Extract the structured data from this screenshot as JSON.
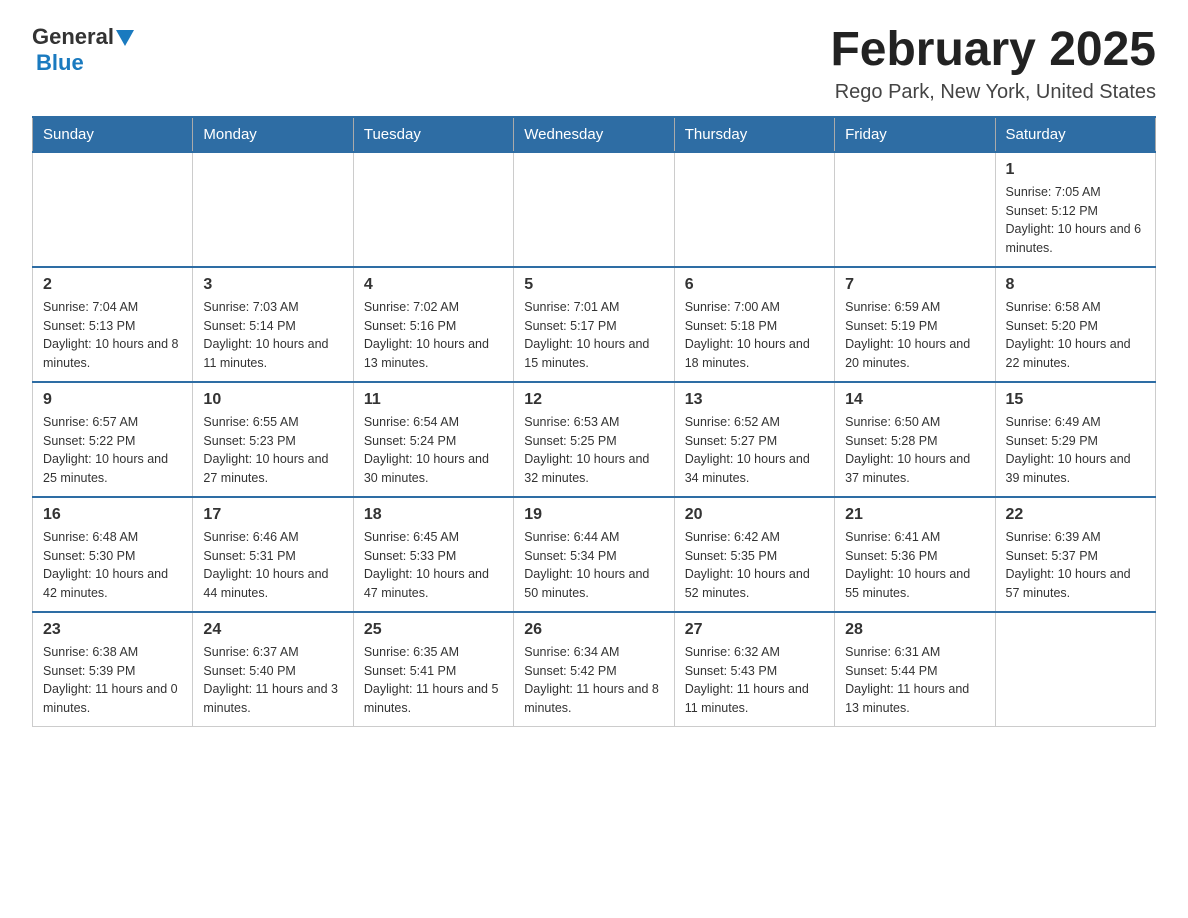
{
  "header": {
    "logo": {
      "general": "General",
      "blue": "Blue",
      "tagline": ""
    },
    "title": "February 2025",
    "location": "Rego Park, New York, United States"
  },
  "calendar": {
    "weekdays": [
      "Sunday",
      "Monday",
      "Tuesday",
      "Wednesday",
      "Thursday",
      "Friday",
      "Saturday"
    ],
    "weeks": [
      [
        {
          "day": "",
          "info": ""
        },
        {
          "day": "",
          "info": ""
        },
        {
          "day": "",
          "info": ""
        },
        {
          "day": "",
          "info": ""
        },
        {
          "day": "",
          "info": ""
        },
        {
          "day": "",
          "info": ""
        },
        {
          "day": "1",
          "info": "Sunrise: 7:05 AM\nSunset: 5:12 PM\nDaylight: 10 hours and 6 minutes."
        }
      ],
      [
        {
          "day": "2",
          "info": "Sunrise: 7:04 AM\nSunset: 5:13 PM\nDaylight: 10 hours and 8 minutes."
        },
        {
          "day": "3",
          "info": "Sunrise: 7:03 AM\nSunset: 5:14 PM\nDaylight: 10 hours and 11 minutes."
        },
        {
          "day": "4",
          "info": "Sunrise: 7:02 AM\nSunset: 5:16 PM\nDaylight: 10 hours and 13 minutes."
        },
        {
          "day": "5",
          "info": "Sunrise: 7:01 AM\nSunset: 5:17 PM\nDaylight: 10 hours and 15 minutes."
        },
        {
          "day": "6",
          "info": "Sunrise: 7:00 AM\nSunset: 5:18 PM\nDaylight: 10 hours and 18 minutes."
        },
        {
          "day": "7",
          "info": "Sunrise: 6:59 AM\nSunset: 5:19 PM\nDaylight: 10 hours and 20 minutes."
        },
        {
          "day": "8",
          "info": "Sunrise: 6:58 AM\nSunset: 5:20 PM\nDaylight: 10 hours and 22 minutes."
        }
      ],
      [
        {
          "day": "9",
          "info": "Sunrise: 6:57 AM\nSunset: 5:22 PM\nDaylight: 10 hours and 25 minutes."
        },
        {
          "day": "10",
          "info": "Sunrise: 6:55 AM\nSunset: 5:23 PM\nDaylight: 10 hours and 27 minutes."
        },
        {
          "day": "11",
          "info": "Sunrise: 6:54 AM\nSunset: 5:24 PM\nDaylight: 10 hours and 30 minutes."
        },
        {
          "day": "12",
          "info": "Sunrise: 6:53 AM\nSunset: 5:25 PM\nDaylight: 10 hours and 32 minutes."
        },
        {
          "day": "13",
          "info": "Sunrise: 6:52 AM\nSunset: 5:27 PM\nDaylight: 10 hours and 34 minutes."
        },
        {
          "day": "14",
          "info": "Sunrise: 6:50 AM\nSunset: 5:28 PM\nDaylight: 10 hours and 37 minutes."
        },
        {
          "day": "15",
          "info": "Sunrise: 6:49 AM\nSunset: 5:29 PM\nDaylight: 10 hours and 39 minutes."
        }
      ],
      [
        {
          "day": "16",
          "info": "Sunrise: 6:48 AM\nSunset: 5:30 PM\nDaylight: 10 hours and 42 minutes."
        },
        {
          "day": "17",
          "info": "Sunrise: 6:46 AM\nSunset: 5:31 PM\nDaylight: 10 hours and 44 minutes."
        },
        {
          "day": "18",
          "info": "Sunrise: 6:45 AM\nSunset: 5:33 PM\nDaylight: 10 hours and 47 minutes."
        },
        {
          "day": "19",
          "info": "Sunrise: 6:44 AM\nSunset: 5:34 PM\nDaylight: 10 hours and 50 minutes."
        },
        {
          "day": "20",
          "info": "Sunrise: 6:42 AM\nSunset: 5:35 PM\nDaylight: 10 hours and 52 minutes."
        },
        {
          "day": "21",
          "info": "Sunrise: 6:41 AM\nSunset: 5:36 PM\nDaylight: 10 hours and 55 minutes."
        },
        {
          "day": "22",
          "info": "Sunrise: 6:39 AM\nSunset: 5:37 PM\nDaylight: 10 hours and 57 minutes."
        }
      ],
      [
        {
          "day": "23",
          "info": "Sunrise: 6:38 AM\nSunset: 5:39 PM\nDaylight: 11 hours and 0 minutes."
        },
        {
          "day": "24",
          "info": "Sunrise: 6:37 AM\nSunset: 5:40 PM\nDaylight: 11 hours and 3 minutes."
        },
        {
          "day": "25",
          "info": "Sunrise: 6:35 AM\nSunset: 5:41 PM\nDaylight: 11 hours and 5 minutes."
        },
        {
          "day": "26",
          "info": "Sunrise: 6:34 AM\nSunset: 5:42 PM\nDaylight: 11 hours and 8 minutes."
        },
        {
          "day": "27",
          "info": "Sunrise: 6:32 AM\nSunset: 5:43 PM\nDaylight: 11 hours and 11 minutes."
        },
        {
          "day": "28",
          "info": "Sunrise: 6:31 AM\nSunset: 5:44 PM\nDaylight: 11 hours and 13 minutes."
        },
        {
          "day": "",
          "info": ""
        }
      ]
    ]
  }
}
